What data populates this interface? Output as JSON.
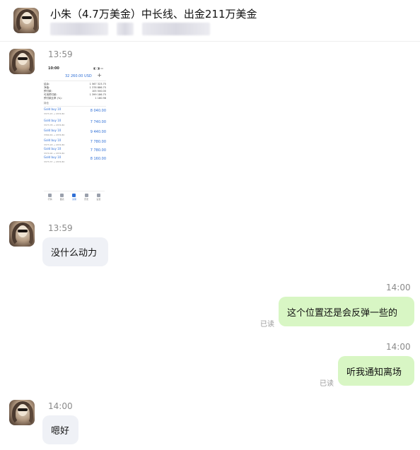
{
  "chat": {
    "title": "小朱（4.7万美金）中长线、出金211万美金"
  },
  "messages": [
    {
      "side": "in",
      "time": "13:59",
      "type": "image"
    },
    {
      "side": "in",
      "time": "13:59",
      "text": "没什么动力"
    },
    {
      "side": "out",
      "time": "14:00",
      "text": "这个位置还是会反弹一些的",
      "status": "已读"
    },
    {
      "side": "out",
      "time": "14:00",
      "text": "听我通知离场",
      "status": "已读"
    },
    {
      "side": "in",
      "time": "14:00",
      "text": "嗯好"
    }
  ],
  "screenshot": {
    "time": "10:00",
    "status": "◧ ◨ ▭",
    "balance": "32 260.00 USD",
    "plus": "+",
    "rows": [
      {
        "k": "结余:",
        "v": "1 567 323.75"
      },
      {
        "k": "净值:",
        "v": "1 378 886.75"
      },
      {
        "k": "预付款:",
        "v": "105 500.00"
      },
      {
        "k": "可用预付款:",
        "v": "1 399 186.75"
      },
      {
        "k": "预付款比率 (%):",
        "v": "1 180.98"
      }
    ],
    "section": "持仓",
    "orders": [
      {
        "name": "Gold buy 10",
        "detail": "3373.15 → 4374.80",
        "profit": "8 040.00"
      },
      {
        "name": "Gold buy 10",
        "detail": "3373.78 → 4374.80",
        "profit": "7 740.00"
      },
      {
        "name": "Gold buy 10",
        "detail": "3369.49 → 4374.80",
        "profit": "9 440.00"
      },
      {
        "name": "Gold buy 10",
        "detail": "3373.18 → 4374.80",
        "profit": "7 780.00"
      },
      {
        "name": "Gold buy 10",
        "detail": "3374.00 → 4374.80",
        "profit": "7 780.00"
      },
      {
        "name": "Gold buy 10",
        "detail": "3373.37 → 4374.80",
        "profit": "8 160.00"
      }
    ],
    "nav": [
      "行情",
      "图表",
      "交易",
      "历史",
      "设置"
    ]
  },
  "icons": {
    "avatar": "avatar-portrait"
  },
  "colors": {
    "incoming_bubble": "#eff1f6",
    "outgoing_bubble": "#d8f6c4",
    "timestamp": "#8a8a8a",
    "link_blue": "#2f6fd6"
  }
}
